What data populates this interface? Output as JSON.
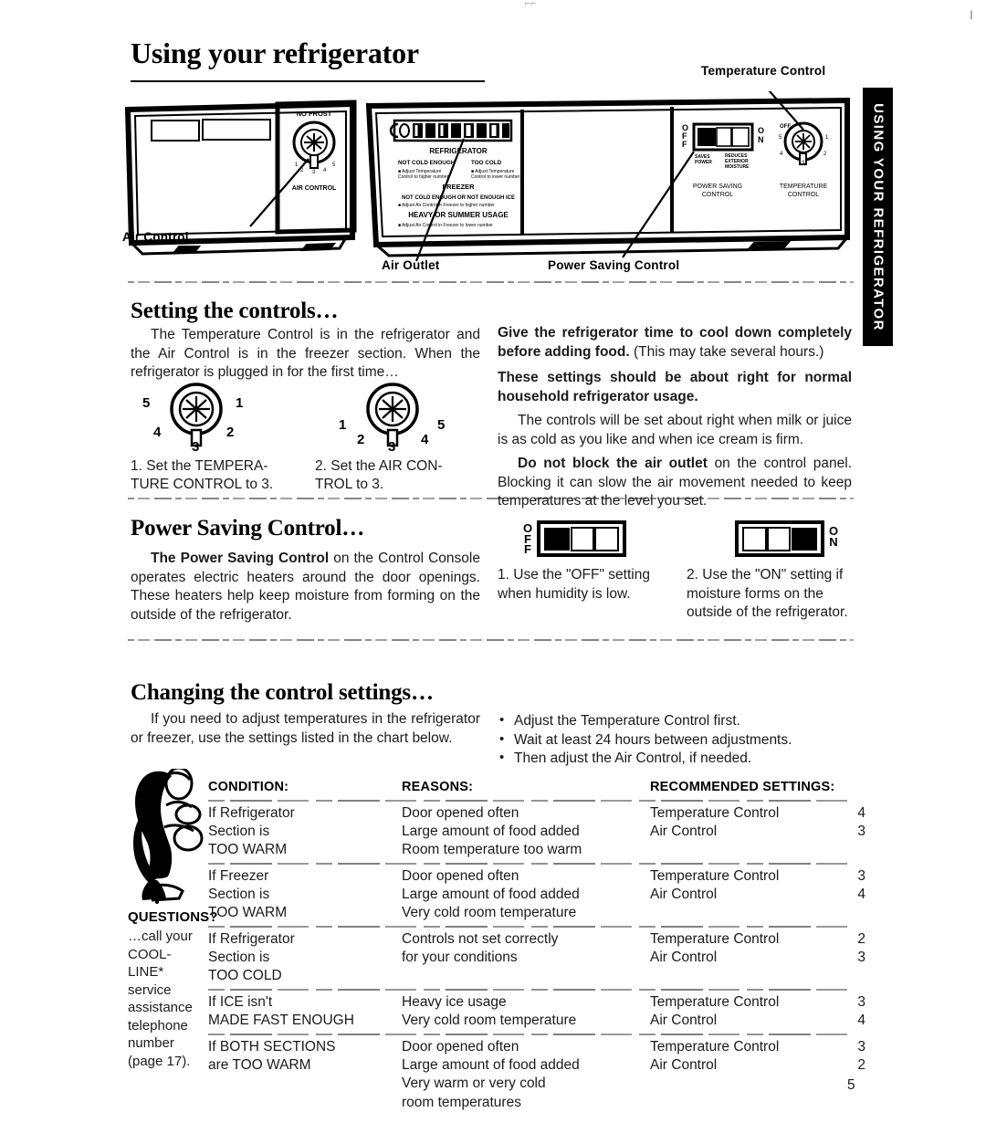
{
  "page": {
    "title": "Using your refrigerator",
    "side_tab": "USING YOUR REFRIGERATOR",
    "page_number": "5",
    "crop_mark_left": "⌐⌐",
    "crop_mark_right": "‖"
  },
  "diagram": {
    "labels": {
      "temperature_control": "Temperature Control",
      "air_control": "Air Control",
      "air_outlet": "Air Outlet",
      "power_saving_control": "Power Saving Control"
    },
    "panel_text": {
      "no_frost": "NO FROST",
      "air_control": "AIR CONTROL",
      "refrigerator": "REFRIGERATOR",
      "not_cold_enough": "NOT COLD ENOUGH",
      "too_cold": "TOO COLD",
      "adjust_higher": "Adjust Temperature Control to higher number",
      "adjust_lower": "Adjust Temperature Control to lower number",
      "freezer": "FREEZER",
      "freezer_line": "NOT COLD ENOUGH OR NOT ENOUGH ICE",
      "freezer_adjust": "Adjust Air Control in Freezer to higher number",
      "heavy_usage": "HEAVY OR SUMMER USAGE",
      "heavy_adjust": "Adjust Air Control in Freezer to lower number",
      "off": "OFF",
      "on": "ON",
      "saves_power": "SAVES POWER",
      "reduces_moisture": "REDUCES EXTERIOR MOISTURE",
      "psc_caption": "POWER SAVING CONTROL",
      "tc_caption": "TEMPERATURE CONTROL",
      "dial_off": "OFF",
      "dial_numbers": [
        "1",
        "2",
        "3",
        "4",
        "5"
      ]
    }
  },
  "setting_controls": {
    "heading": "Setting the controls…",
    "intro": "The Temperature Control is in the refrigerator and the Air Control is in the freezer section. When the refrigerator is plugged in for the first time…",
    "dials": [
      {
        "name": "temperature-control-dial",
        "numbers": {
          "left": "5",
          "right": "1",
          "lower_left": "4",
          "lower_right": "2",
          "bottom": "3"
        },
        "caption_number": "1.",
        "caption": "Set the TEMPERA-\nTURE CONTROL to 3."
      },
      {
        "name": "air-control-dial",
        "numbers": {
          "left": "1",
          "right": "5",
          "lower_left": "2",
          "lower_right": "4",
          "bottom": "3"
        },
        "caption_number": "2.",
        "caption": "Set the AIR CON-\nTROL to 3."
      }
    ],
    "right_column": {
      "p1_bold": "Give the refrigerator time to cool down completely before adding food.",
      "p1_rest": " (This may take several hours.)",
      "p2_bold": "These settings should be about right for normal household refrigerator usage.",
      "p3": "The controls will be set about right when milk or juice is as cold as you like and when ice cream is firm.",
      "p4_bold": "Do not block the air outlet",
      "p4_rest": " on the control panel. Blocking it can slow the air movement needed to keep temperatures at the level you set."
    }
  },
  "power_saving": {
    "heading": "Power Saving Control…",
    "body_bold": "The Power Saving Control",
    "body_rest": " on the Control Console operates electric heaters around the door openings. These heaters help keep moisture from forming on the outside of the refrigerator.",
    "switches": [
      {
        "name": "off-switch",
        "letters": [
          "O",
          "F",
          "F"
        ],
        "letters_position": "left",
        "slider_position": "left",
        "step_number": "1.",
        "caption": "Use the \"OFF\" setting when humidity is low."
      },
      {
        "name": "on-switch",
        "letters": [
          "O",
          "N"
        ],
        "letters_position": "right",
        "slider_position": "right",
        "step_number": "2.",
        "caption": "Use the \"ON\" setting if moisture forms on the outside of the refrigerator."
      }
    ]
  },
  "changing_settings": {
    "heading": "Changing the control settings…",
    "intro": "If you need to adjust temperatures in the refrigerator or freezer, use the settings listed in the chart below.",
    "bullets": [
      "Adjust the Temperature Control first.",
      "Wait at least 24 hours between adjustments.",
      "Then adjust the Air Control, if needed."
    ],
    "questions": {
      "title": "QUESTIONS?",
      "body": "…call your COOL-LINE* service assistance telephone number (page 17)."
    },
    "table": {
      "headers": [
        "CONDITION:",
        "REASONS:",
        "RECOMMENDED SETTINGS:"
      ],
      "rows": [
        {
          "condition": [
            "If Refrigerator",
            "Section is",
            "TOO WARM"
          ],
          "reasons": [
            "Door opened often",
            "Large amount of food added",
            "Room temperature too warm"
          ],
          "settings": [
            {
              "label": "Temperature Control",
              "value": "4"
            },
            {
              "label": "Air Control",
              "value": "3"
            }
          ]
        },
        {
          "condition": [
            "If Freezer",
            "Section is",
            "TOO WARM"
          ],
          "reasons": [
            "Door opened often",
            "Large amount of food added",
            "Very cold room temperature"
          ],
          "settings": [
            {
              "label": "Temperature Control",
              "value": "3"
            },
            {
              "label": "Air Control",
              "value": "4"
            }
          ]
        },
        {
          "condition": [
            "If Refrigerator",
            "Section is",
            "TOO COLD"
          ],
          "reasons": [
            "Controls not set correctly",
            "for your conditions"
          ],
          "settings": [
            {
              "label": "Temperature Control",
              "value": "2"
            },
            {
              "label": "Air Control",
              "value": "3"
            }
          ]
        },
        {
          "condition": [
            "If ICE isn't",
            "MADE FAST ENOUGH"
          ],
          "reasons": [
            "Heavy ice usage",
            "Very cold room temperature"
          ],
          "settings": [
            {
              "label": "Temperature Control",
              "value": "3"
            },
            {
              "label": "Air Control",
              "value": "4"
            }
          ]
        },
        {
          "condition": [
            "If BOTH SECTIONS",
            "are TOO WARM"
          ],
          "reasons": [
            "Door opened often",
            "Large amount of food added",
            "Very warm or very cold",
            "room temperatures"
          ],
          "settings": [
            {
              "label": "Temperature Control",
              "value": "3"
            },
            {
              "label": "Air Control",
              "value": "2"
            }
          ]
        }
      ]
    }
  }
}
